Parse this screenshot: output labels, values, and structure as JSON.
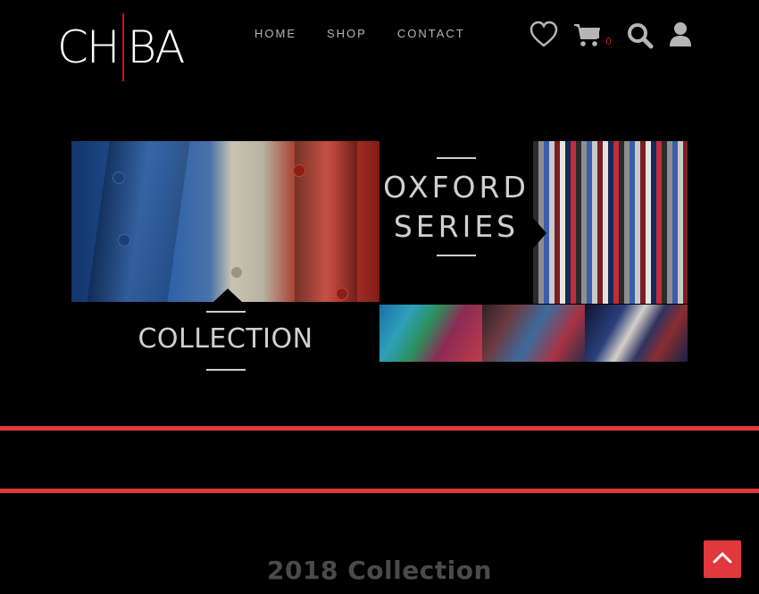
{
  "header": {
    "logo_left": "CH",
    "logo_right": "BA",
    "nav": [
      "HOME",
      "SHOP",
      "CONTACT"
    ],
    "cart_count": "0"
  },
  "icons": {
    "wishlist": "heart-icon",
    "cart": "cart-icon",
    "search": "search-icon",
    "account": "user-icon",
    "back_to_top": "chevron-up-icon"
  },
  "hero": {
    "oxford_line1": "OXFORD",
    "oxford_line2": "SERIES",
    "collection_label": "COLLECTION"
  },
  "section": {
    "heading": "2018 Collection"
  },
  "colors": {
    "background": "#000000",
    "accent_red": "#e0383d",
    "nav_text": "#b5b5b5",
    "logo_bar": "#c8101e"
  }
}
